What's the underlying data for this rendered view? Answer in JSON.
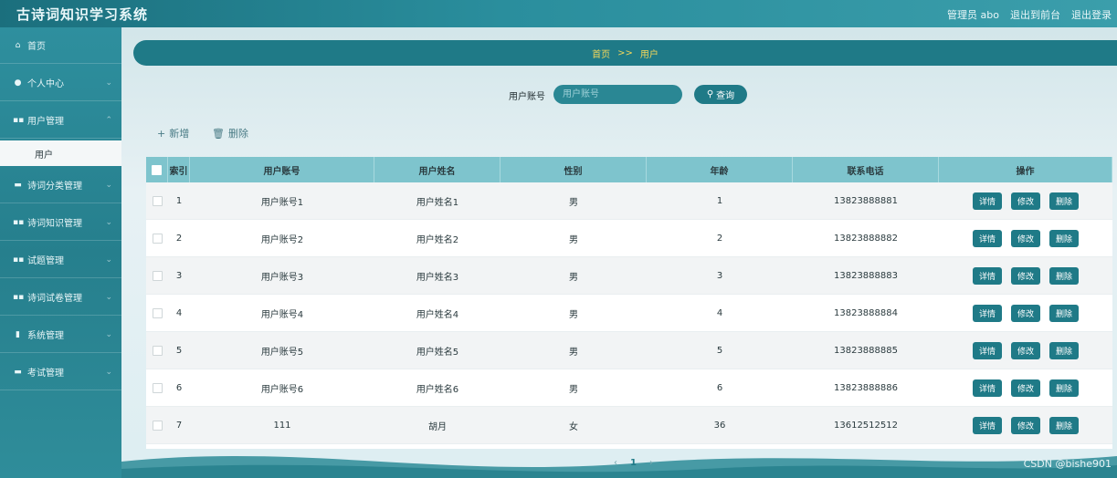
{
  "header": {
    "title": "古诗词知识学习系统",
    "user": "管理员 abo",
    "to_admin": "退出到前台",
    "logout": "退出登录"
  },
  "sidebar": {
    "items": [
      {
        "label": "首页",
        "icon": "home-icon"
      },
      {
        "label": "个人中心",
        "icon": "user-icon"
      },
      {
        "label": "用户管理",
        "icon": "grid-icon"
      },
      {
        "label": "诗词分类管理",
        "icon": "book-icon"
      },
      {
        "label": "诗词知识管理",
        "icon": "grid-icon"
      },
      {
        "label": "试题管理",
        "icon": "grid-icon"
      },
      {
        "label": "诗词试卷管理",
        "icon": "grid-icon"
      },
      {
        "label": "系统管理",
        "icon": "lock-icon"
      },
      {
        "label": "考试管理",
        "icon": "list-icon"
      }
    ],
    "sub_item": "用户"
  },
  "breadcrumb": {
    "home": "首页",
    "sep": ">>",
    "current": "用户"
  },
  "search": {
    "label": "用户账号",
    "placeholder": "用户账号",
    "button": "查询"
  },
  "actions": {
    "add": "新增",
    "delete": "删除"
  },
  "table": {
    "columns": [
      "索引",
      "用户账号",
      "用户姓名",
      "性别",
      "年龄",
      "联系电话",
      "操作"
    ],
    "rows": [
      {
        "idx": "1",
        "account": "用户账号1",
        "name": "用户姓名1",
        "sex": "男",
        "age": "1",
        "phone": "13823888881"
      },
      {
        "idx": "2",
        "account": "用户账号2",
        "name": "用户姓名2",
        "sex": "男",
        "age": "2",
        "phone": "13823888882"
      },
      {
        "idx": "3",
        "account": "用户账号3",
        "name": "用户姓名3",
        "sex": "男",
        "age": "3",
        "phone": "13823888883"
      },
      {
        "idx": "4",
        "account": "用户账号4",
        "name": "用户姓名4",
        "sex": "男",
        "age": "4",
        "phone": "13823888884"
      },
      {
        "idx": "5",
        "account": "用户账号5",
        "name": "用户姓名5",
        "sex": "男",
        "age": "5",
        "phone": "13823888885"
      },
      {
        "idx": "6",
        "account": "用户账号6",
        "name": "用户姓名6",
        "sex": "男",
        "age": "6",
        "phone": "13823888886"
      },
      {
        "idx": "7",
        "account": "111",
        "name": "胡月",
        "sex": "女",
        "age": "36",
        "phone": "13612512512"
      }
    ],
    "ops": {
      "detail": "详情",
      "edit": "修改",
      "delete": "删除"
    }
  },
  "pager": {
    "prev": "‹",
    "page": "1",
    "next": "›"
  },
  "watermark": "CSDN @bishe901",
  "colors": {
    "primary": "#1f7a87",
    "header_bg": "#7ec4cd",
    "breadcrumb_text": "#f3d75a"
  }
}
